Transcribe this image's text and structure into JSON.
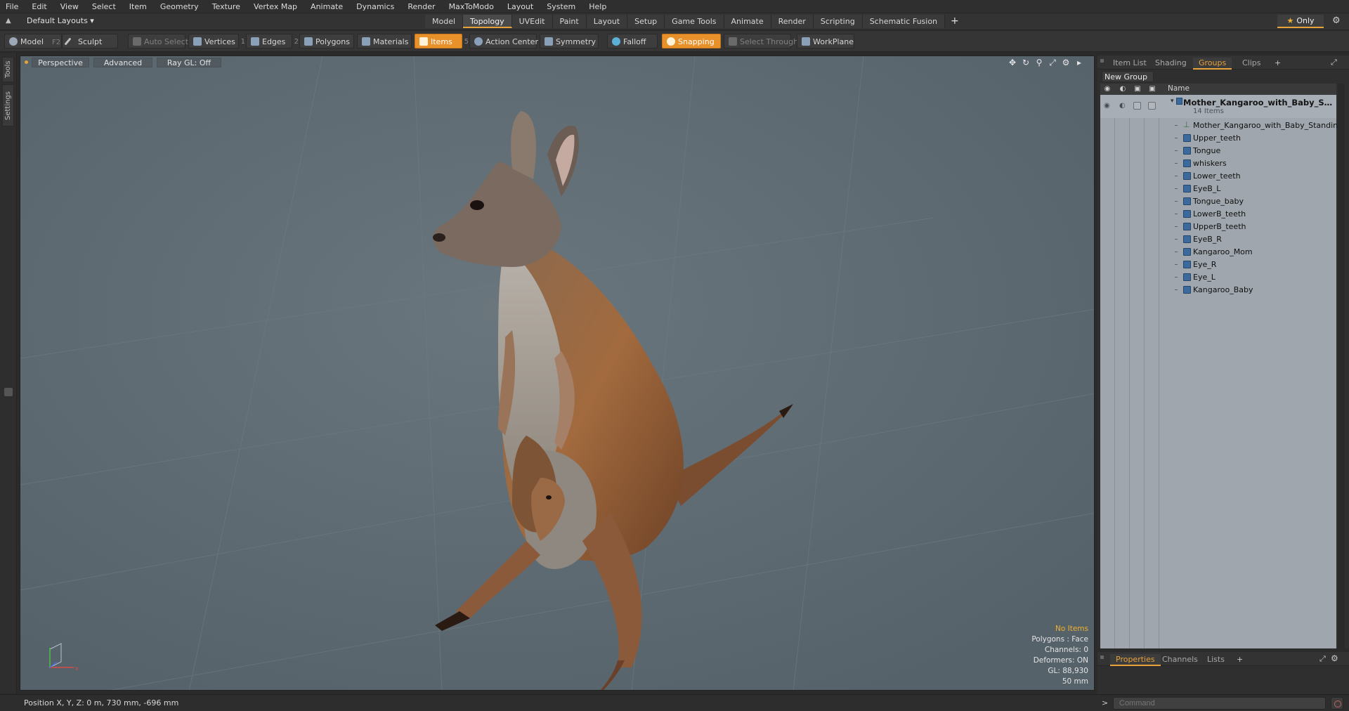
{
  "menu": [
    "File",
    "Edit",
    "View",
    "Select",
    "Item",
    "Geometry",
    "Texture",
    "Vertex Map",
    "Animate",
    "Dynamics",
    "Render",
    "MaxToModo",
    "Layout",
    "System",
    "Help"
  ],
  "layout_select": "Default Layouts ▾",
  "tabs": [
    "Model",
    "Topology",
    "UVEdit",
    "Paint",
    "Layout",
    "Setup",
    "Game Tools",
    "Animate",
    "Render",
    "Scripting",
    "Schematic Fusion"
  ],
  "active_tab": "Topology",
  "tab_add": "+",
  "only_label": "Only",
  "toolbar": {
    "model": "Model",
    "model_key": "F2",
    "sculpt": "Sculpt",
    "auto_select": "Auto Select",
    "vertices": "Vertices",
    "vertices_count": "1",
    "edges": "Edges",
    "edges_count": "2",
    "polygons": "Polygons",
    "materials": "Materials",
    "items": "Items",
    "items_count": "5",
    "action_center": "Action Center",
    "symmetry": "Symmetry",
    "falloff": "Falloff",
    "snapping": "Snapping",
    "select_through": "Select Through",
    "workplane": "WorkPlane"
  },
  "left_tabs": {
    "tools": "Tools",
    "settings": "Settings"
  },
  "viewport": {
    "perspective": "Perspective",
    "advanced": "Advanced",
    "raygl": "Ray GL: Off",
    "info": {
      "no_items": "No Items",
      "polygons": "Polygons : Face",
      "channels": "Channels: 0",
      "deformers": "Deformers: ON",
      "gl": "GL: 88,930",
      "focal": "50 mm"
    }
  },
  "right_panel": {
    "tabs": [
      "Item List",
      "Shading",
      "Groups",
      "Clips"
    ],
    "active_tab": "Groups",
    "tab_add": "+",
    "new_group": "New Group",
    "name_header": "Name",
    "group_name": "Mother_Kangaroo_with_Baby_Sta...",
    "group_count": "14 Items",
    "mesh_item": "Mother_Kangaroo_with_Baby_Standing",
    "items": [
      "Upper_teeth",
      "Tongue",
      "whiskers",
      "Lower_teeth",
      "EyeB_L",
      "Tongue_baby",
      "LowerB_teeth",
      "UpperB_teeth",
      "EyeB_R",
      "Kangaroo_Mom",
      "Eye_R",
      "Eye_L",
      "Kangaroo_Baby"
    ]
  },
  "bottom_panel": {
    "tabs": [
      "Properties",
      "Channels",
      "Lists"
    ],
    "active_tab": "Properties",
    "tab_add": "+"
  },
  "status": {
    "position": "Position X, Y, Z:   0 m, 730 mm, -696 mm",
    "command_prompt": ">",
    "command_placeholder": "Command"
  },
  "colors": {
    "accent": "#e8a23a",
    "viewport_bg": "#5f6b72",
    "list_bg": "#9fa6ad"
  }
}
